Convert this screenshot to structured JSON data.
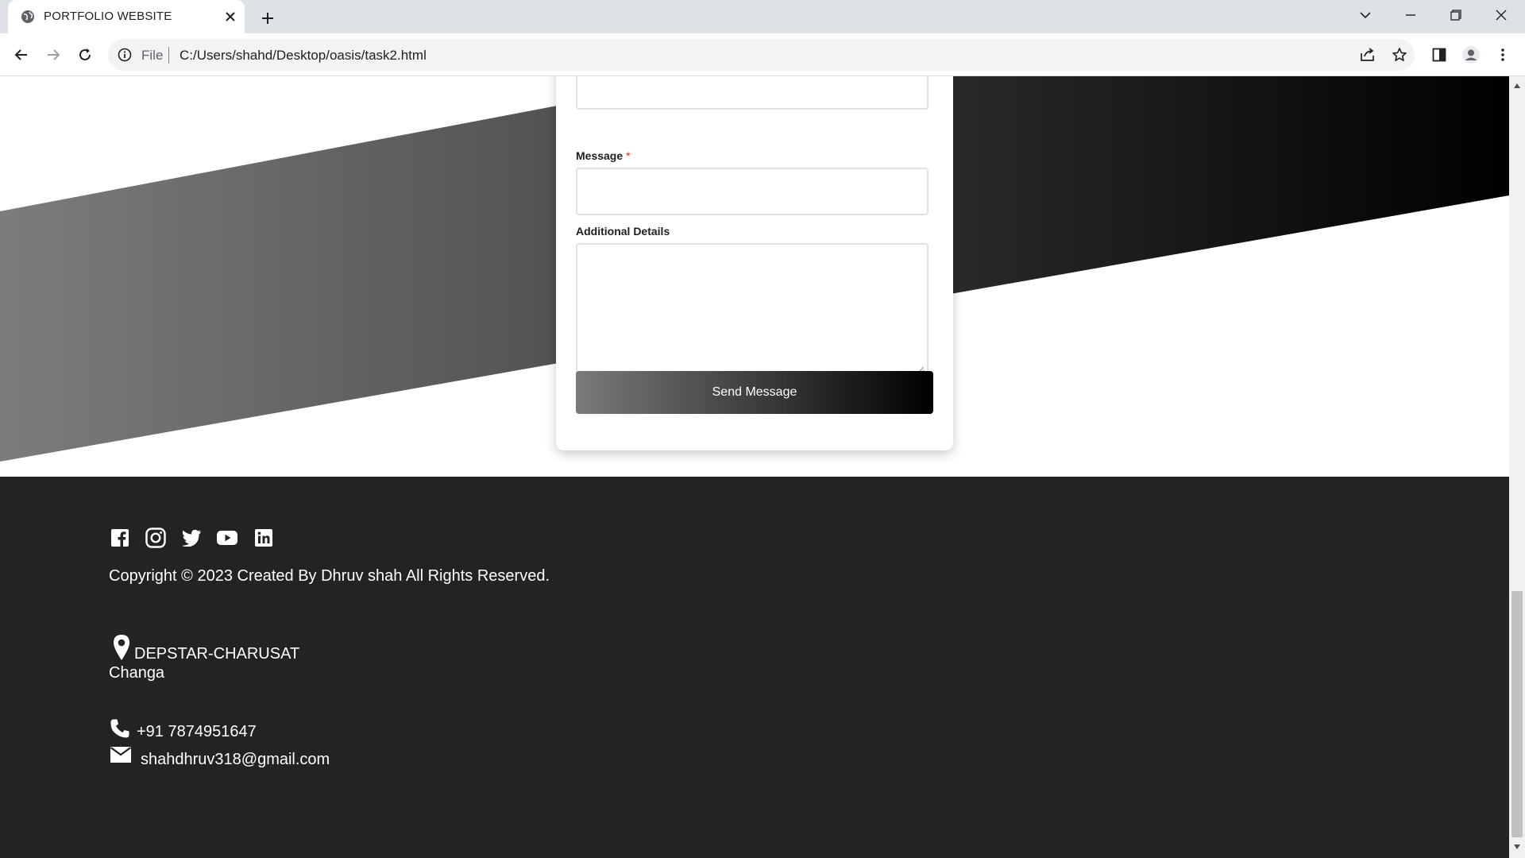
{
  "browser": {
    "tab_title": "PORTFOLIO WEBSITE",
    "address": {
      "scheme_label": "File",
      "url": "C:/Users/shahd/Desktop/oasis/task2.html"
    },
    "icons": {
      "favicon": "globe-icon",
      "close": "close-icon",
      "new_tab": "plus-icon",
      "back": "back-arrow-icon",
      "forward": "forward-arrow-icon",
      "reload": "reload-icon",
      "info": "info-icon",
      "share": "share-icon",
      "bookmark": "star-icon",
      "side_panel": "side-panel-icon",
      "profile": "profile-icon",
      "menu": "more-vert-icon"
    }
  },
  "contact_form": {
    "message_label": "Message",
    "required_mark": "*",
    "details_label": "Additional Details",
    "submit_label": "Send Message",
    "button_gradient": [
      "#7a7a7a",
      "#000000"
    ]
  },
  "footer": {
    "social_icons": [
      "facebook-icon",
      "instagram-icon",
      "twitter-icon",
      "youtube-icon",
      "linkedin-icon"
    ],
    "copyright": "Copyright © 2023 Created By Dhruv shah All Rights Reserved.",
    "address_line1": "DEPSTAR-CHARUSAT",
    "address_line2": "Changa",
    "phone": "+91 7874951647",
    "email": "shahdhruv318@gmail.com",
    "background": "#232323"
  }
}
